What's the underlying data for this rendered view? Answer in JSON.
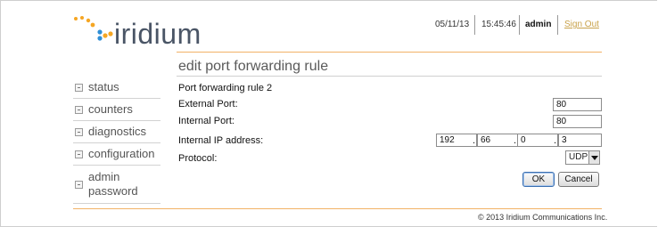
{
  "brand": {
    "name": "iridium",
    "dot_color": "#f5a623",
    "text_color": "#4a5566"
  },
  "header": {
    "date": "05/11/13",
    "time": "15:45:46",
    "user": "admin",
    "signout_label": "Sign Out"
  },
  "page_title": "edit port forwarding rule",
  "sidebar": {
    "items": [
      {
        "label": "status"
      },
      {
        "label": "counters"
      },
      {
        "label": "diagnostics"
      },
      {
        "label": "configuration"
      },
      {
        "label": "admin password"
      }
    ]
  },
  "form": {
    "heading": "Port forwarding rule 2",
    "external_port": {
      "label": "External Port:",
      "value": "80"
    },
    "internal_port": {
      "label": "Internal Port:",
      "value": "80"
    },
    "internal_ip": {
      "label": "Internal IP address:",
      "octets": [
        "192",
        "66",
        "0",
        "3"
      ]
    },
    "protocol": {
      "label": "Protocol:",
      "value": "UDP"
    },
    "ok_label": "OK",
    "cancel_label": "Cancel"
  },
  "footer": {
    "copyright": "© 2013 Iridium Communications Inc."
  },
  "colors": {
    "accent_line": "#f2b266",
    "signout": "#c9a24a"
  }
}
